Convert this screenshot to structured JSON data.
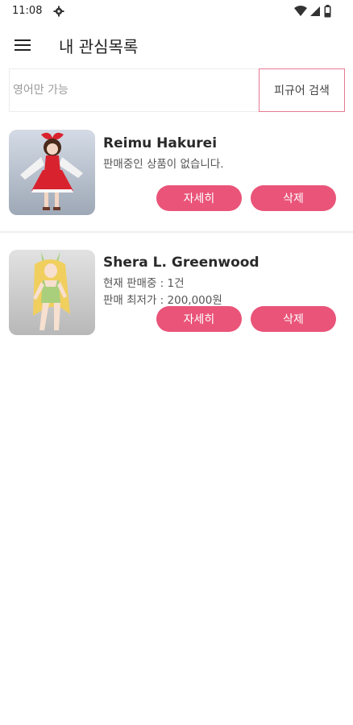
{
  "status_bar": {
    "time": "11:08"
  },
  "app_bar": {
    "title": "내 관심목록"
  },
  "search": {
    "placeholder": "영어만 가능",
    "button_label": "피규어 검색"
  },
  "items": [
    {
      "name": "Reimu Hakurei",
      "lines": [
        "판매중인 상품이 없습니다."
      ],
      "detail_label": "자세히",
      "delete_label": "삭제"
    },
    {
      "name": "Shera L. Greenwood",
      "lines": [
        "현재 판매중 : 1건",
        "판매 최저가 : 200,000원"
      ],
      "detail_label": "자세히",
      "delete_label": "삭제"
    }
  ],
  "colors": {
    "accent": "#ea5479",
    "search_border": "#e8788f"
  }
}
